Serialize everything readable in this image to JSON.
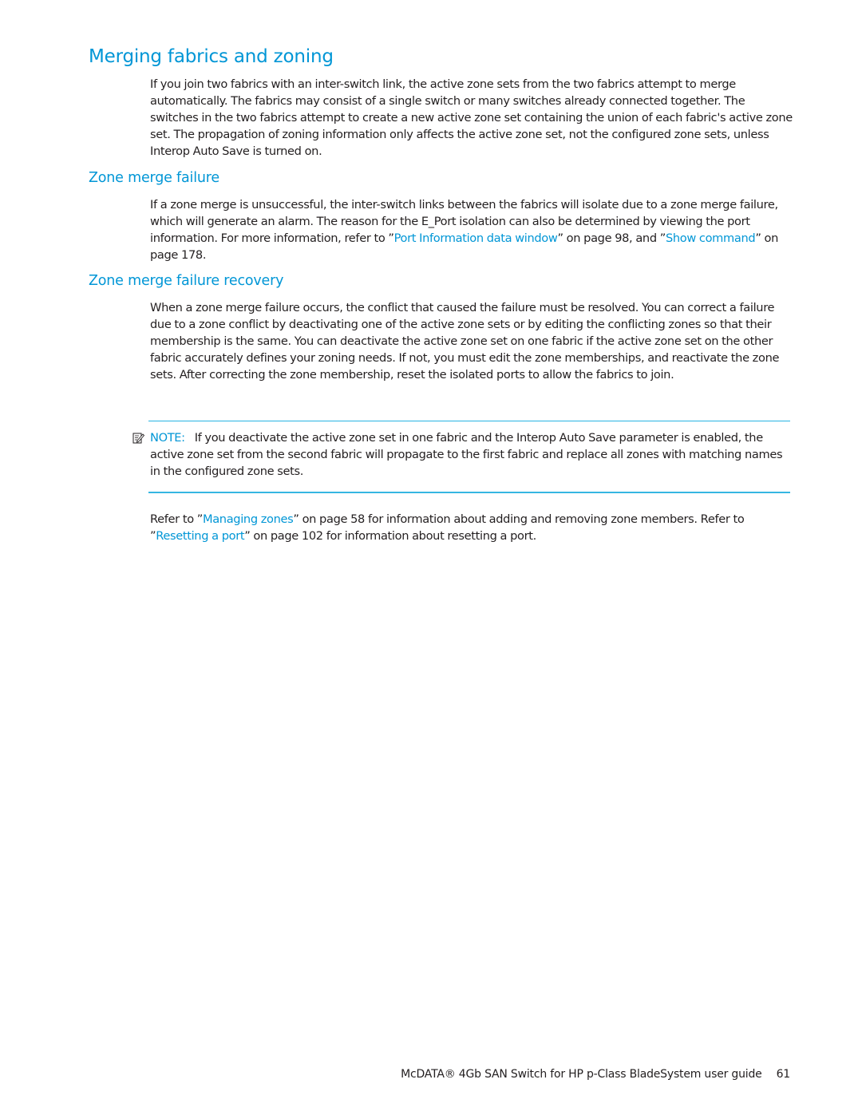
{
  "document": {
    "title": "Merging fabrics and zoning",
    "intro": "If you join two fabrics with an inter-switch link, the active zone sets from the two fabrics attempt to merge automatically. The fabrics may consist of a single switch or many switches already connected together. The switches in the two fabrics attempt to create a new active zone set containing the union of each fabric's active zone set. The propagation of zoning information only affects the active zone set, not the configured zone sets, unless Interop Auto Save is turned on.",
    "sections": [
      {
        "heading": "Zone merge failure",
        "text_before_link1": "If a zone merge is unsuccessful, the inter-switch links between the fabrics will isolate due to a zone merge failure, which will generate an alarm. The reason for the E_Port isolation can also be determined by viewing the port information. For more information, refer to ”",
        "link1": "Port Information data window",
        "text_between": "” on page 98, and ”",
        "link2": "Show command",
        "text_after": "” on page 178."
      },
      {
        "heading": "Zone merge failure recovery",
        "text": "When a zone merge failure occurs, the conflict that caused the failure must be resolved. You can correct a failure due to a zone conflict by deactivating one of the active zone sets or by editing the conflicting zones so that their membership is the same. You can deactivate the active zone set on one fabric if the active zone set on the other fabric accurately defines your zoning needs. If not, you must edit the zone memberships, and reactivate the zone sets. After correcting the zone membership, reset the isolated ports to allow the fabrics to join."
      }
    ],
    "note": {
      "icon": "note-pencil-icon",
      "label": "NOTE:",
      "text": "If you deactivate the active zone set in one fabric and the Interop Auto Save parameter is enabled, the active zone set from the second fabric will propagate to the first fabric and replace all zones with matching names in the configured zone sets."
    },
    "refer": {
      "text1": "Refer to ”",
      "link1": "Managing zones",
      "text2": "” on page 58 for information about adding and removing zone members. Refer to ”",
      "link2": "Resetting a port",
      "text3": "” on page 102 for information about resetting a port."
    },
    "footer": {
      "guide_title": "McDATA® 4Gb SAN Switch for HP p-Class BladeSystem user guide",
      "page_number": "61"
    },
    "colors": {
      "accent": "#0096d6",
      "text": "#231f20",
      "rule": "#28b4e4"
    }
  }
}
